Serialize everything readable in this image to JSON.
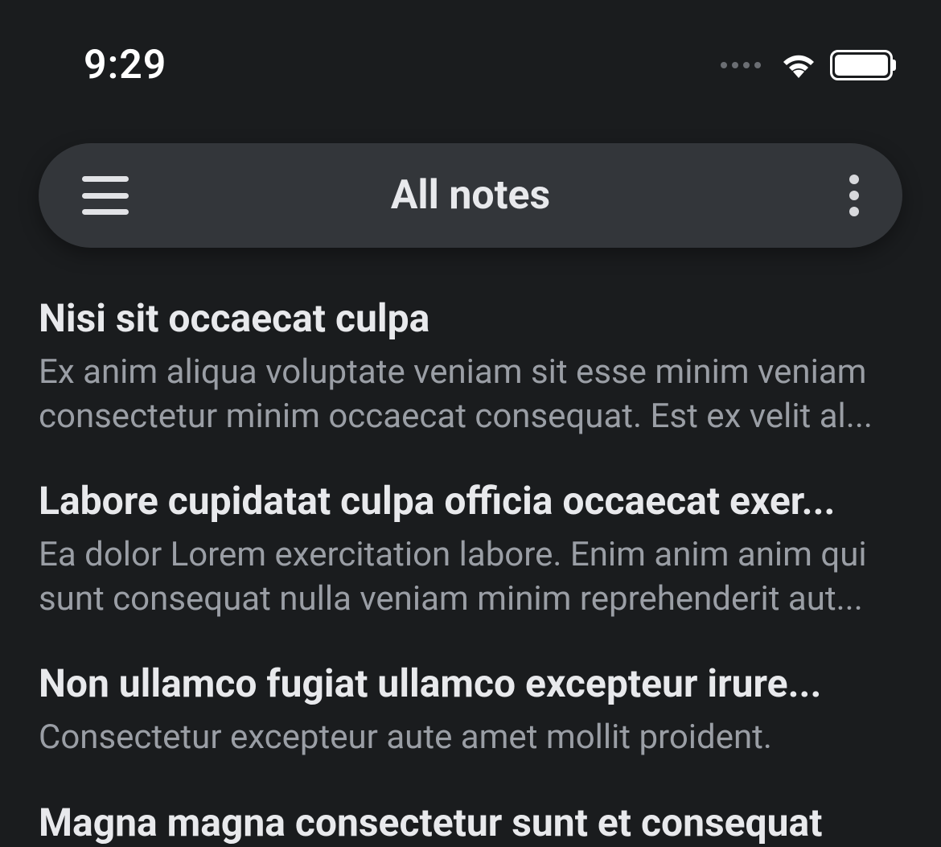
{
  "status": {
    "time": "9:29"
  },
  "header": {
    "title": "All notes"
  },
  "notes": [
    {
      "title": "Nisi sit occaecat culpa",
      "preview": "Ex anim aliqua voluptate veniam sit esse minim veniam consectetur minim occaecat consequat. Est ex velit al..."
    },
    {
      "title": "Labore cupidatat culpa officia occaecat exer...",
      "preview": "Ea dolor Lorem exercitation labore. Enim anim anim qui sunt consequat nulla veniam minim reprehenderit aut..."
    },
    {
      "title": "Non ullamco fugiat ullamco excepteur irure...",
      "preview": "Consectetur excepteur aute amet mollit proident."
    },
    {
      "title": "Magna magna consectetur sunt et consequat",
      "preview": ""
    }
  ]
}
